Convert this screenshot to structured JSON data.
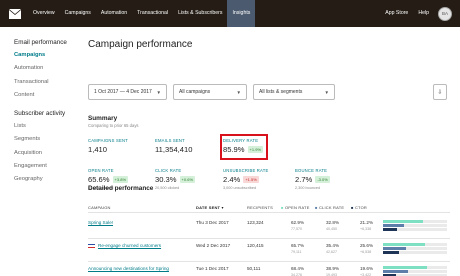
{
  "nav": {
    "items": [
      "Overview",
      "Campaigns",
      "Automation",
      "Transactional",
      "Lists & Subscribers",
      "Insights"
    ],
    "active_index": 5,
    "right": [
      "App Store",
      "Help"
    ],
    "avatar_initials": "BA"
  },
  "sidebar": {
    "email_heading": "Email performance",
    "email_items": [
      "Campaigns",
      "Automation",
      "Transactional",
      "Content"
    ],
    "subscriber_heading": "Subscriber activity",
    "subscriber_items": [
      "Lists",
      "Segments",
      "Acquisition",
      "Engagement",
      "Geography"
    ]
  },
  "page": {
    "title": "Campaign performance",
    "filters": {
      "date_range": "1 Oct 2017 — 4 Dec 2017",
      "campaigns": "All campaigns",
      "lists": "All lists & segments"
    },
    "export_icon": "download-icon"
  },
  "summary": {
    "title": "Summary",
    "subtitle": "Comparing to prior 65 days",
    "metrics": [
      {
        "label": "CAMPAIGNS SENT",
        "value": "1,410",
        "delta": "",
        "sub": ""
      },
      {
        "label": "EMAILS SENT",
        "value": "11,354,410",
        "delta": "",
        "sub": ""
      },
      {
        "label": "DELIVERY RATE",
        "value": "85.9%",
        "delta": "+1.9%",
        "sub": ""
      },
      {
        "label": "OPEN RATE",
        "value": "65.6%",
        "delta": "+3.8%",
        "sub": "44,464 opened"
      },
      {
        "label": "CLICK RATE",
        "value": "30.3%",
        "delta": "+0.6%",
        "sub": "20,500 clicked"
      },
      {
        "label": "UNSUBSCRIBE RATE",
        "value": "2.4%",
        "delta": "+1.5%",
        "sub": "3,000 unsubscribed"
      },
      {
        "label": "BOUNCE RATE",
        "value": "2.7%",
        "delta": "-3.0%",
        "sub": "2,300 bounced"
      }
    ]
  },
  "detail": {
    "title": "Detailed performance",
    "columns": [
      "CAMPAIGN",
      "DATE SENT",
      "RECIPIENTS",
      "OPEN RATE",
      "CLICK RATE",
      "CTOR"
    ],
    "sort_indicator": "▾",
    "rows": [
      {
        "campaign": "Spring Sale!",
        "flag": "",
        "date": "Thu 3 Dec 2017",
        "recipients": "123,324",
        "open": "62.9%",
        "open_sub": "77,570",
        "click": "32.8%",
        "click_sub": "40,450",
        "ctor": "21.2%",
        "ctor_sub": "+6,338",
        "open_frac": 0.629,
        "click_frac": 0.328,
        "ctor_frac": 0.212
      },
      {
        "campaign": "Re-engage churned customers",
        "flag": "fr",
        "date": "Wed 2 Dec 2017",
        "recipients": "120,415",
        "open": "65.7%",
        "open_sub": "79,111",
        "click": "35.4%",
        "click_sub": "42,627",
        "ctor": "25.6%",
        "ctor_sub": "+6,538",
        "open_frac": 0.657,
        "click_frac": 0.354,
        "ctor_frac": 0.256
      },
      {
        "campaign": "Announcing new destinations for Spring",
        "flag": "",
        "date": "Tue 1 Dec 2017",
        "recipients": "50,111",
        "open": "68.4%",
        "open_sub": "34,276",
        "click": "38.9%",
        "click_sub": "19,493",
        "ctor": "19.6%",
        "ctor_sub": "+3,422",
        "open_frac": 0.684,
        "click_frac": 0.389,
        "ctor_frac": 0.196
      }
    ]
  },
  "colors": {
    "nav_bg": "#241c15",
    "accent": "#007c89",
    "bar_open": "#7ee0c3",
    "bar_click": "#5d7ea8",
    "bar_ctor": "#1f3557",
    "highlight": "#d8111c"
  }
}
